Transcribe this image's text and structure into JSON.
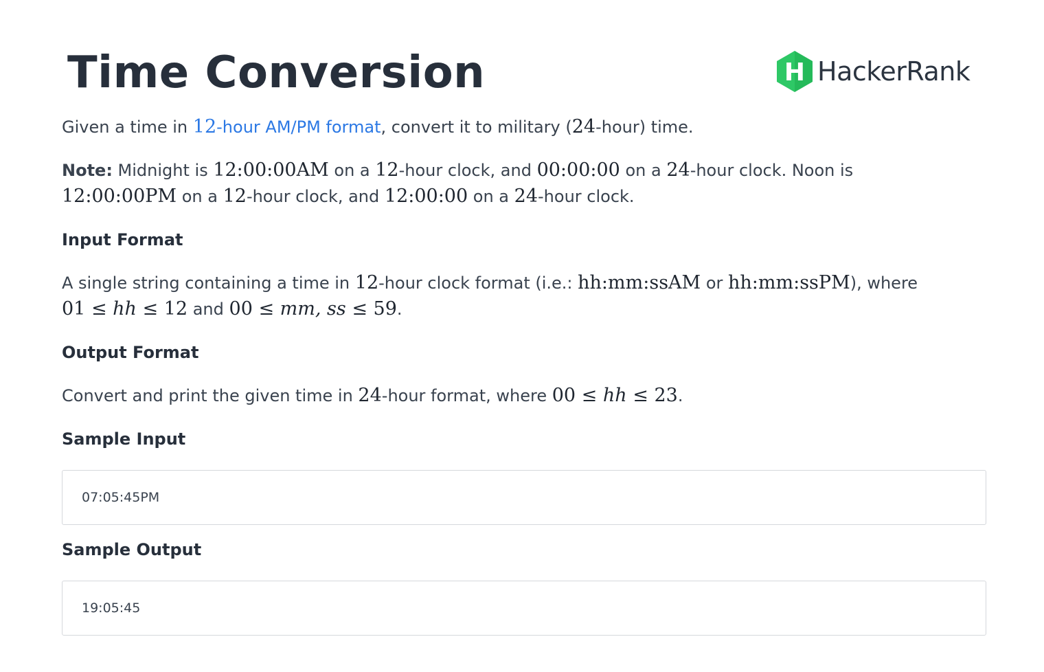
{
  "title": "Time Conversion",
  "brand": {
    "name": "HackerRank",
    "letter": "H",
    "color": "#2ec866"
  },
  "intro": {
    "t1": "Given a time in ",
    "link_num": "12",
    "link_text": "-hour AM/PM format",
    "t2": ", convert it to military (",
    "m1": "24",
    "t3": "-hour) time."
  },
  "note": {
    "label": "Note:",
    "t1": " Midnight is ",
    "m1": "12:00:00AM",
    "t2": " on a ",
    "m2": "12",
    "t3": "-hour clock, and ",
    "m3": "00:00:00",
    "t4": " on a ",
    "m4": "24",
    "t5": "-hour clock. Noon is",
    "m5": "12:00:00PM",
    "t6": " on a ",
    "m6": "12",
    "t7": "-hour clock, and ",
    "m7": "12:00:00",
    "t8": " on a ",
    "m8": "24",
    "t9": "-hour clock."
  },
  "input_format": {
    "heading": "Input Format",
    "t1": "A single string containing a time in ",
    "m1": "12",
    "t2": "-hour clock format (i.e.: ",
    "m2": "hh:mm:ssAM",
    "t3": " or ",
    "m3": "hh:mm:ssPM",
    "t4": "), where",
    "m4": "01 ≤ ",
    "v1": "hh",
    "m5": " ≤ 12",
    "t5": " and ",
    "m6": "00 ≤ ",
    "v2": "mm, ss",
    "m7": " ≤ 59",
    "t6": "."
  },
  "output_format": {
    "heading": "Output Format",
    "t1": "Convert and print the given time in ",
    "m1": "24",
    "t2": "-hour format, where ",
    "m2": "00 ≤ ",
    "v1": "hh",
    "m3": " ≤ 23",
    "t3": "."
  },
  "sample_input": {
    "heading": "Sample Input",
    "value": "07:05:45PM"
  },
  "sample_output": {
    "heading": "Sample Output",
    "value": "19:05:45"
  }
}
